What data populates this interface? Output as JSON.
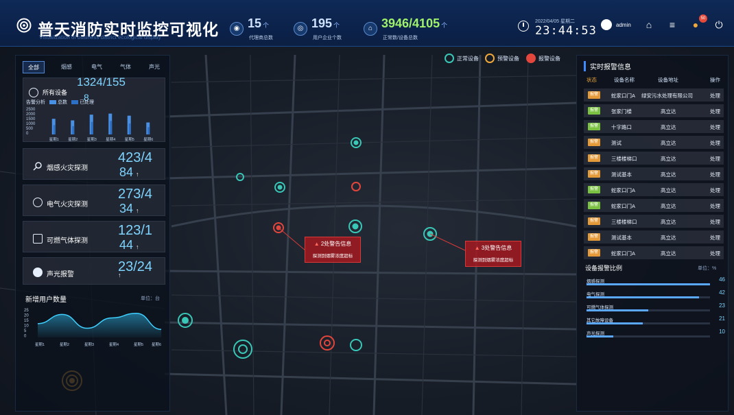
{
  "header": {
    "title": "普天消防实时监控可视化",
    "subtitle": "Visualization of business district ecological display",
    "stats": [
      {
        "value": "15",
        "unit": "个",
        "label": "代理商总数",
        "icon": "agent-icon"
      },
      {
        "value": "195",
        "unit": "个",
        "label": "用户企业个数",
        "icon": "company-icon"
      },
      {
        "value": "3946/4105",
        "unit": "个",
        "label": "正常数/设备总数",
        "icon": "device-icon"
      }
    ],
    "date": "2022/04/05 星期二",
    "time": "23:44:53",
    "user": "admin",
    "notification_count": "50"
  },
  "left": {
    "tabs": [
      "全部",
      "烟感",
      "电气",
      "气体",
      "声光"
    ],
    "all_devices": {
      "label": "所有设备",
      "value": "1324/155",
      "overlay": "8",
      "legend_title": "告警分析",
      "legend_total": "总数",
      "legend_processed": "已处理"
    },
    "categories": [
      {
        "label": "烟感火灾探测",
        "top": "423/4",
        "bottom": "84",
        "arrow": "↑"
      },
      {
        "label": "电气火灾探测",
        "top": "273/4",
        "bottom": "34",
        "arrow": "↑"
      },
      {
        "label": "可燃气体探测",
        "top": "123/1",
        "bottom": "44",
        "arrow": "↑"
      },
      {
        "label": "声光报警",
        "top": "23/24",
        "bottom": "",
        "arrow": "↑"
      }
    ],
    "new_users": {
      "title": "新增用户数量",
      "unit": "单位：台"
    }
  },
  "chart_data": [
    {
      "type": "bar",
      "title": "告警分析",
      "categories": [
        "星期1",
        "星期2",
        "星期3",
        "星期4",
        "星期5",
        "星期6"
      ],
      "yticks": [
        "2500",
        "2000",
        "1500",
        "1000",
        "500",
        "0"
      ],
      "ylim": [
        0,
        2500
      ],
      "series": [
        {
          "name": "总数",
          "values": [
            1500,
            1350,
            1900,
            2000,
            1800,
            1150
          ],
          "color": "#4a90e2"
        },
        {
          "name": "已处理",
          "values": [
            900,
            800,
            1200,
            1300,
            1050,
            700
          ],
          "color": "#2d6fc4"
        }
      ]
    },
    {
      "type": "area",
      "title": "新增用户数量",
      "categories": [
        "星期1",
        "星期2",
        "星期3",
        "星期4",
        "星期5",
        "星期6"
      ],
      "yticks": [
        "25",
        "20",
        "15",
        "10",
        "5",
        "0"
      ],
      "ylim": [
        0,
        25
      ],
      "values": [
        12,
        20,
        8,
        17,
        21,
        7
      ]
    }
  ],
  "map_legend": [
    {
      "label": "正常设备",
      "color": "#39c7b7"
    },
    {
      "label": "预警设备",
      "color": "#f0a83a"
    },
    {
      "label": "报警设备",
      "color": "#e2463c"
    }
  ],
  "alarms": [
    {
      "title": "2处警告信息",
      "detail": "探测到烟雾浓度超标"
    },
    {
      "title": "3处警告信息",
      "detail": "探测到烟雾浓度超标"
    }
  ],
  "right": {
    "title": "实时报警信息",
    "columns": [
      "状态",
      "设备名称",
      "设备地址",
      "操作"
    ],
    "rows": [
      {
        "status": "报警",
        "status_color": "#e59a3a",
        "name": "蛇家口门A",
        "address": "绿安污水处理有限公司",
        "action": "处理"
      },
      {
        "status": "报警",
        "status_color": "#7cc242",
        "name": "张家门楼",
        "address": "高立达",
        "action": "处理"
      },
      {
        "status": "报警",
        "status_color": "#7cc242",
        "name": "十字路口",
        "address": "高立达",
        "action": "处理"
      },
      {
        "status": "报警",
        "status_color": "#e59a3a",
        "name": "测试",
        "address": "高立达",
        "action": "处理"
      },
      {
        "status": "报警",
        "status_color": "#e59a3a",
        "name": "三楼楼梯口",
        "address": "高立达",
        "action": "处理"
      },
      {
        "status": "报警",
        "status_color": "#e59a3a",
        "name": "测试基本",
        "address": "高立达",
        "action": "处理"
      },
      {
        "status": "报警",
        "status_color": "#7cc242",
        "name": "蛇家口门A",
        "address": "高立达",
        "action": "处理"
      },
      {
        "status": "报警",
        "status_color": "#7cc242",
        "name": "蛇家口门A",
        "address": "高立达",
        "action": "处理"
      },
      {
        "status": "报警",
        "status_color": "#e59a3a",
        "name": "三楼楼梯口",
        "address": "高立达",
        "action": "处理"
      },
      {
        "status": "报警",
        "status_color": "#e59a3a",
        "name": "测试基本",
        "address": "高立达",
        "action": "处理"
      },
      {
        "status": "报警",
        "status_color": "#e59a3a",
        "name": "蛇家口门A",
        "address": "高立达",
        "action": "处理"
      }
    ],
    "ratio_title": "设备报警比例",
    "ratio_unit": "单位：%",
    "ratios": [
      {
        "label": "烟感探测",
        "value": 46
      },
      {
        "label": "电气探测",
        "value": 42
      },
      {
        "label": "可燃气体探测",
        "value": 23
      },
      {
        "label": "其它故障设备",
        "value": 21
      },
      {
        "label": "声光探测",
        "value": 10
      }
    ]
  }
}
